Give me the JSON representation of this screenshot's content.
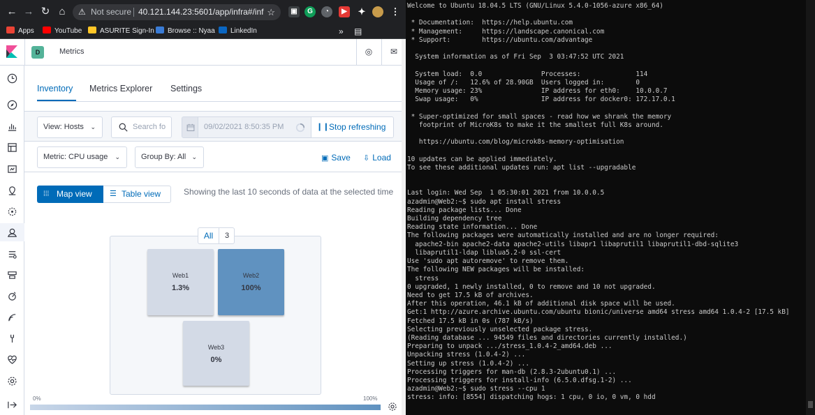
{
  "browser": {
    "omnibox": {
      "security_label": "Not secure",
      "url": "40.121.144.23:5601/app/infra#/infra..."
    },
    "bookmarks": [
      {
        "label": "Apps",
        "color": "#ea4335"
      },
      {
        "label": "YouTube",
        "color": "#ff0000"
      },
      {
        "label": "ASURITE Sign-In",
        "color": "#ffc627"
      },
      {
        "label": "Browse :: Nyaa",
        "color": "#3a7bd5"
      },
      {
        "label": "LinkedIn",
        "color": "#0a66c2"
      }
    ],
    "bookmarks_overflow": "»"
  },
  "kibana": {
    "space_initial": "D",
    "app_title": "Metrics",
    "tabs": [
      "Inventory",
      "Metrics Explorer",
      "Settings"
    ],
    "view_select": "View: Hosts",
    "search_placeholder": "Search fo",
    "date_value": "09/02/2021 8:50:35 PM",
    "stop_refreshing": "Stop refreshing",
    "metric_select": "Metric: CPU usage",
    "group_by_select": "Group By: All",
    "save_label": "Save",
    "load_label": "Load",
    "map_view_label": "Map view",
    "table_view_label": "Table view",
    "showing_text": "Showing the last 10 seconds of data at the selected time",
    "group": {
      "label": "All",
      "count": "3"
    },
    "nodes": [
      {
        "name": "Web1",
        "value": "1.3%",
        "fill": "#d3dae6"
      },
      {
        "name": "Web2",
        "value": "100%",
        "fill": "#6092c0"
      },
      {
        "name": "Web3",
        "value": "0%",
        "fill": "#d3dae6"
      }
    ],
    "legend": {
      "min": "0%",
      "max": "100%",
      "min_color": "#c8d6e8",
      "max_color": "#6092c0"
    }
  },
  "terminal": {
    "lines": [
      "Welcome to Ubuntu 18.04.5 LTS (GNU/Linux 5.4.0-1056-azure x86_64)",
      "",
      " * Documentation:  https://help.ubuntu.com",
      " * Management:     https://landscape.canonical.com",
      " * Support:        https://ubuntu.com/advantage",
      "",
      "  System information as of Fri Sep  3 03:47:52 UTC 2021",
      "",
      "  System load:  0.0               Processes:              114",
      "  Usage of /:   12.6% of 28.90GB  Users logged in:        0",
      "  Memory usage: 23%               IP address for eth0:    10.0.0.7",
      "  Swap usage:   0%                IP address for docker0: 172.17.0.1",
      "",
      " * Super-optimized for small spaces - read how we shrank the memory",
      "   footprint of MicroK8s to make it the smallest full K8s around.",
      "",
      "   https://ubuntu.com/blog/microk8s-memory-optimisation",
      "",
      "10 updates can be applied immediately.",
      "To see these additional updates run: apt list --upgradable",
      "",
      "",
      "Last login: Wed Sep  1 05:30:01 2021 from 10.0.0.5",
      "azadmin@Web2:~$ sudo apt install stress",
      "Reading package lists... Done",
      "Building dependency tree",
      "Reading state information... Done",
      "The following packages were automatically installed and are no longer required:",
      "  apache2-bin apache2-data apache2-utils libapr1 libaprutil1 libaprutil1-dbd-sqlite3",
      "  libaprutil1-ldap liblua5.2-0 ssl-cert",
      "Use 'sudo apt autoremove' to remove them.",
      "The following NEW packages will be installed:",
      "  stress",
      "0 upgraded, 1 newly installed, 0 to remove and 10 not upgraded.",
      "Need to get 17.5 kB of archives.",
      "After this operation, 46.1 kB of additional disk space will be used.",
      "Get:1 http://azure.archive.ubuntu.com/ubuntu bionic/universe amd64 stress amd64 1.0.4-2 [17.5 kB]",
      "Fetched 17.5 kB in 0s (787 kB/s)",
      "Selecting previously unselected package stress.",
      "(Reading database ... 94549 files and directories currently installed.)",
      "Preparing to unpack .../stress_1.0.4-2_amd64.deb ...",
      "Unpacking stress (1.0.4-2) ...",
      "Setting up stress (1.0.4-2) ...",
      "Processing triggers for man-db (2.8.3-2ubuntu0.1) ...",
      "Processing triggers for install-info (6.5.0.dfsg.1-2) ...",
      "azadmin@Web2:~$ sudo stress --cpu 1",
      "stress: info: [8554] dispatching hogs: 1 cpu, 0 io, 0 vm, 0 hdd"
    ]
  }
}
